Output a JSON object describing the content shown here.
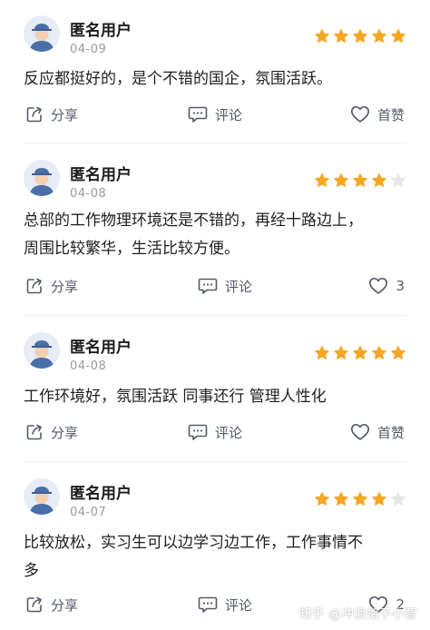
{
  "colors": {
    "star_filled": "#f5a623",
    "star_empty": "#e6e6e6",
    "action_gray": "#555a66",
    "avatar_bg": "#e7ecf6",
    "avatar_blue": "#4a6fa8"
  },
  "icons": {
    "share": "share-icon",
    "comment": "comment-icon",
    "like": "heart-icon",
    "star": "star-icon",
    "avatar": "anonymous-avatar-icon"
  },
  "reviews": [
    {
      "username": "匿名用户",
      "date": "04-09",
      "rating": 5,
      "content_lines": [
        "反应都挺好的，是个不错的国企，氛围活跃。"
      ],
      "share_label": "分享",
      "comment_label": "评论",
      "like_label": "首赞"
    },
    {
      "username": "匿名用户",
      "date": "04-08",
      "rating": 4,
      "content_lines": [
        "总部的工作物理环境还是不错的，再经十路边上，",
        "周围比较繁华，生活比较方便。"
      ],
      "share_label": "分享",
      "comment_label": "评论",
      "like_label": "3"
    },
    {
      "username": "匿名用户",
      "date": "04-08",
      "rating": 5,
      "content_lines": [
        "工作环境好，氛围活跃 同事还行 管理人性化"
      ],
      "share_label": "分享",
      "comment_label": "评论",
      "like_label": "首赞"
    },
    {
      "username": "匿名用户",
      "date": "04-07",
      "rating": 4,
      "content_lines": [
        "比较放松，实习生可以边学习边工作，工作事情不",
        "多"
      ],
      "share_label": "分享",
      "comment_label": "评论",
      "like_label": "2"
    }
  ],
  "watermark": "知乎 @冲浪拾子小智"
}
